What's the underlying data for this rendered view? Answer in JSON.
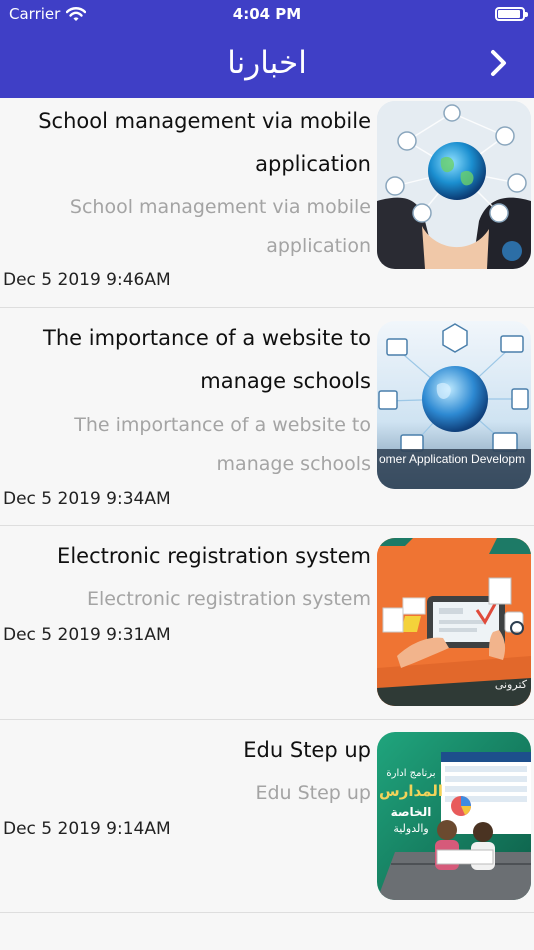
{
  "status_bar": {
    "carrier": "Carrier",
    "time": "4:04 PM"
  },
  "nav": {
    "title": "اخبارنا",
    "background_color": "#3f3fc6",
    "back_icon": "chevron-right-icon"
  },
  "news": [
    {
      "title": "School management via mobile application",
      "subtitle": "School management via mobile application",
      "date": "Dec  5 2019  9:46AM",
      "thumbnail_icon": "network-globe-image"
    },
    {
      "title": "The importance of a website to manage schools",
      "subtitle": "The importance of a website to manage schools",
      "date": "Dec  5 2019  9:34AM",
      "thumbnail_icon": "globe-network-image",
      "thumbnail_text": "omer Application Developm"
    },
    {
      "title": "Electronic registration system",
      "subtitle": "Electronic registration system",
      "date": "Dec  5 2019  9:31AM",
      "thumbnail_icon": "tablet-registration-image",
      "thumbnail_text": "كترونى"
    },
    {
      "title": "Edu Step up",
      "subtitle": "Edu Step up",
      "date": "Dec  5 2019  9:14AM",
      "thumbnail_icon": "school-management-program-image",
      "thumbnail_text_1": "برنامج ادارة",
      "thumbnail_text_2": "المدارس",
      "thumbnail_text_3": "الخاصة",
      "thumbnail_text_4": "والدولية"
    }
  ]
}
